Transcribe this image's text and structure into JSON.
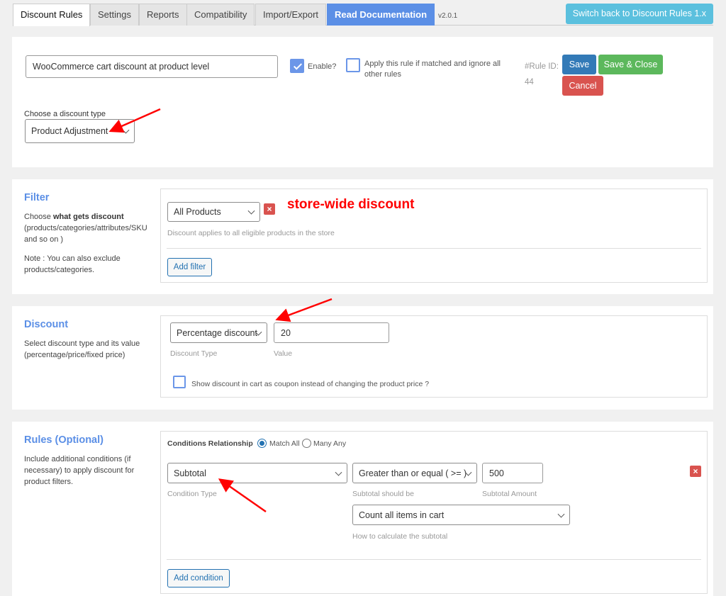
{
  "tabs": [
    {
      "label": "Discount Rules",
      "active": true
    },
    {
      "label": "Settings",
      "active": false
    },
    {
      "label": "Reports",
      "active": false
    },
    {
      "label": "Compatibility",
      "active": false
    },
    {
      "label": "Import/Export",
      "active": false
    },
    {
      "label": "Read Documentation",
      "active": false
    }
  ],
  "version": "v2.0.1",
  "switch_back_label": "Switch back to Discount Rules 1.x",
  "rule": {
    "name_value": "WooCommerce cart discount at product level",
    "enable_label": "Enable?",
    "enable_checked": true,
    "exclusive_label": "Apply this rule if matched and ignore all other rules",
    "exclusive_checked": false,
    "rule_id_label": "#Rule ID:",
    "rule_id_value": "44",
    "save_label": "Save",
    "save_close_label": "Save & Close",
    "cancel_label": "Cancel",
    "discount_type_label": "Choose a discount type",
    "discount_type_value": "Product Adjustment"
  },
  "filter": {
    "title": "Filter",
    "desc_prefix": "Choose ",
    "desc_bold": "what gets discount",
    "desc_rest": "(products/categories/attributes/SKU and so on )",
    "note": "Note : You can also exclude products/categories.",
    "select_value": "All Products",
    "remove_icon": "×",
    "hint": "Discount applies to all eligible products in the store",
    "add_label": "Add filter"
  },
  "discount": {
    "title": "Discount",
    "desc": "Select discount type and its value (percentage/price/fixed price)",
    "type_value": "Percentage discount",
    "type_hint": "Discount Type",
    "value_value": "20",
    "value_hint": "Value",
    "coupon_label": "Show discount in cart as coupon instead of changing the product price ?",
    "coupon_checked": false
  },
  "rules": {
    "title": "Rules (Optional)",
    "desc": "Include additional conditions (if necessary) to apply discount for product filters.",
    "relationship_label": "Conditions Relationship",
    "match_all_label": "Match All",
    "many_any_label": "Many Any",
    "selected_relationship": "Match All",
    "condition_type_value": "Subtotal",
    "condition_type_hint": "Condition Type",
    "operator_value": "Greater than or equal ( >= )",
    "operator_hint": "Subtotal should be",
    "amount_value": "500",
    "amount_hint": "Subtotal Amount",
    "calc_value": "Count all items in cart",
    "calc_hint": "How to calculate the subtotal",
    "remove_icon": "×",
    "add_label": "Add condition"
  },
  "annotations": {
    "store_wide": "store-wide discount",
    "color": "#ff0000"
  }
}
